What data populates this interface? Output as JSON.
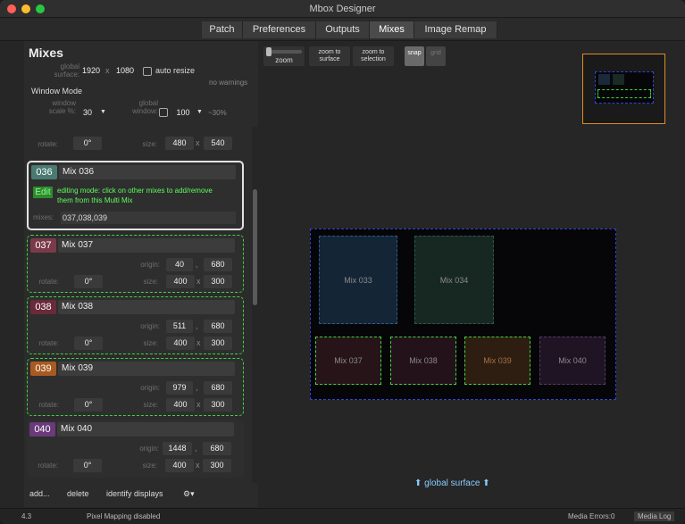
{
  "window": {
    "title": "Mbox Designer"
  },
  "tabs": [
    {
      "label": "Patch"
    },
    {
      "label": "Preferences"
    },
    {
      "label": "Outputs"
    },
    {
      "label": "Mixes"
    },
    {
      "label": "Image Remap"
    }
  ],
  "panel": {
    "title": "Mixes",
    "global_surface_label": "global surface:",
    "surface_w": "1920",
    "surface_x": "x",
    "surface_h": "1080",
    "auto_resize": "auto resize",
    "no_warnings": "no warnings",
    "window_mode": "Window Mode",
    "window_scale_label": "window scale %:",
    "window_scale": "30",
    "global_window_label": "global window:",
    "global_window_value": "100",
    "approx": "~30%",
    "first": {
      "rotate_label": "rotate:",
      "rotate": "0°",
      "size_label": "size:",
      "size_w": "480",
      "x": "x",
      "size_h": "540"
    },
    "mixes": [
      {
        "id": "036",
        "name": "Mix 036",
        "edit_label": "Edit",
        "edit_note": "editing mode: click on other mixes to add/remove them from this Multi Mix",
        "mixes_label": "mixes:",
        "mixes_value": "037,038,039"
      },
      {
        "id": "037",
        "name": "Mix 037",
        "origin_label": "origin:",
        "origin_x": "40",
        "comma": ",",
        "origin_y": "680",
        "rotate_label": "rotate:",
        "rotate": "0°",
        "size_label": "size:",
        "size_w": "400",
        "x": "x",
        "size_h": "300"
      },
      {
        "id": "038",
        "name": "Mix 038",
        "origin_label": "origin:",
        "origin_x": "511",
        "comma": ",",
        "origin_y": "680",
        "rotate_label": "rotate:",
        "rotate": "0°",
        "size_label": "size:",
        "size_w": "400",
        "x": "x",
        "size_h": "300"
      },
      {
        "id": "039",
        "name": "Mix 039",
        "origin_label": "origin:",
        "origin_x": "979",
        "comma": ",",
        "origin_y": "680",
        "rotate_label": "rotate:",
        "rotate": "0°",
        "size_label": "size:",
        "size_w": "400",
        "x": "x",
        "size_h": "300"
      },
      {
        "id": "040",
        "name": "Mix 040",
        "origin_label": "origin:",
        "origin_x": "1448",
        "comma": ",",
        "origin_y": "680",
        "rotate_label": "rotate:",
        "rotate": "0°",
        "size_label": "size:",
        "size_w": "400",
        "x": "x",
        "size_h": "300"
      }
    ],
    "toolbar": {
      "add": "add...",
      "delete": "delete",
      "identify": "identify displays"
    }
  },
  "canvas": {
    "zoom": "zoom",
    "zoom_surface": "zoom to surface",
    "zoom_selection": "zoom to selection",
    "snap": "snap",
    "grid": "grid",
    "surface_label": "global surface",
    "mix_rects": [
      "Mix 033",
      "Mix 034",
      "Mix 037",
      "Mix 038",
      "Mix 039",
      "Mix 040"
    ]
  },
  "status": {
    "version": "4.3",
    "pixel_mapping": "Pixel Mapping disabled",
    "media_errors": "Media Errors:0",
    "media_log": "Media Log"
  },
  "colors": {
    "selection": "#3fd43f",
    "surface_border": "#3344cc",
    "tag_036": "#4a7a72",
    "tag_037": "#7a3a4a",
    "tag_038": "#6a2a3a",
    "tag_039": "#a85a20",
    "tag_040": "#6a3a7a"
  }
}
